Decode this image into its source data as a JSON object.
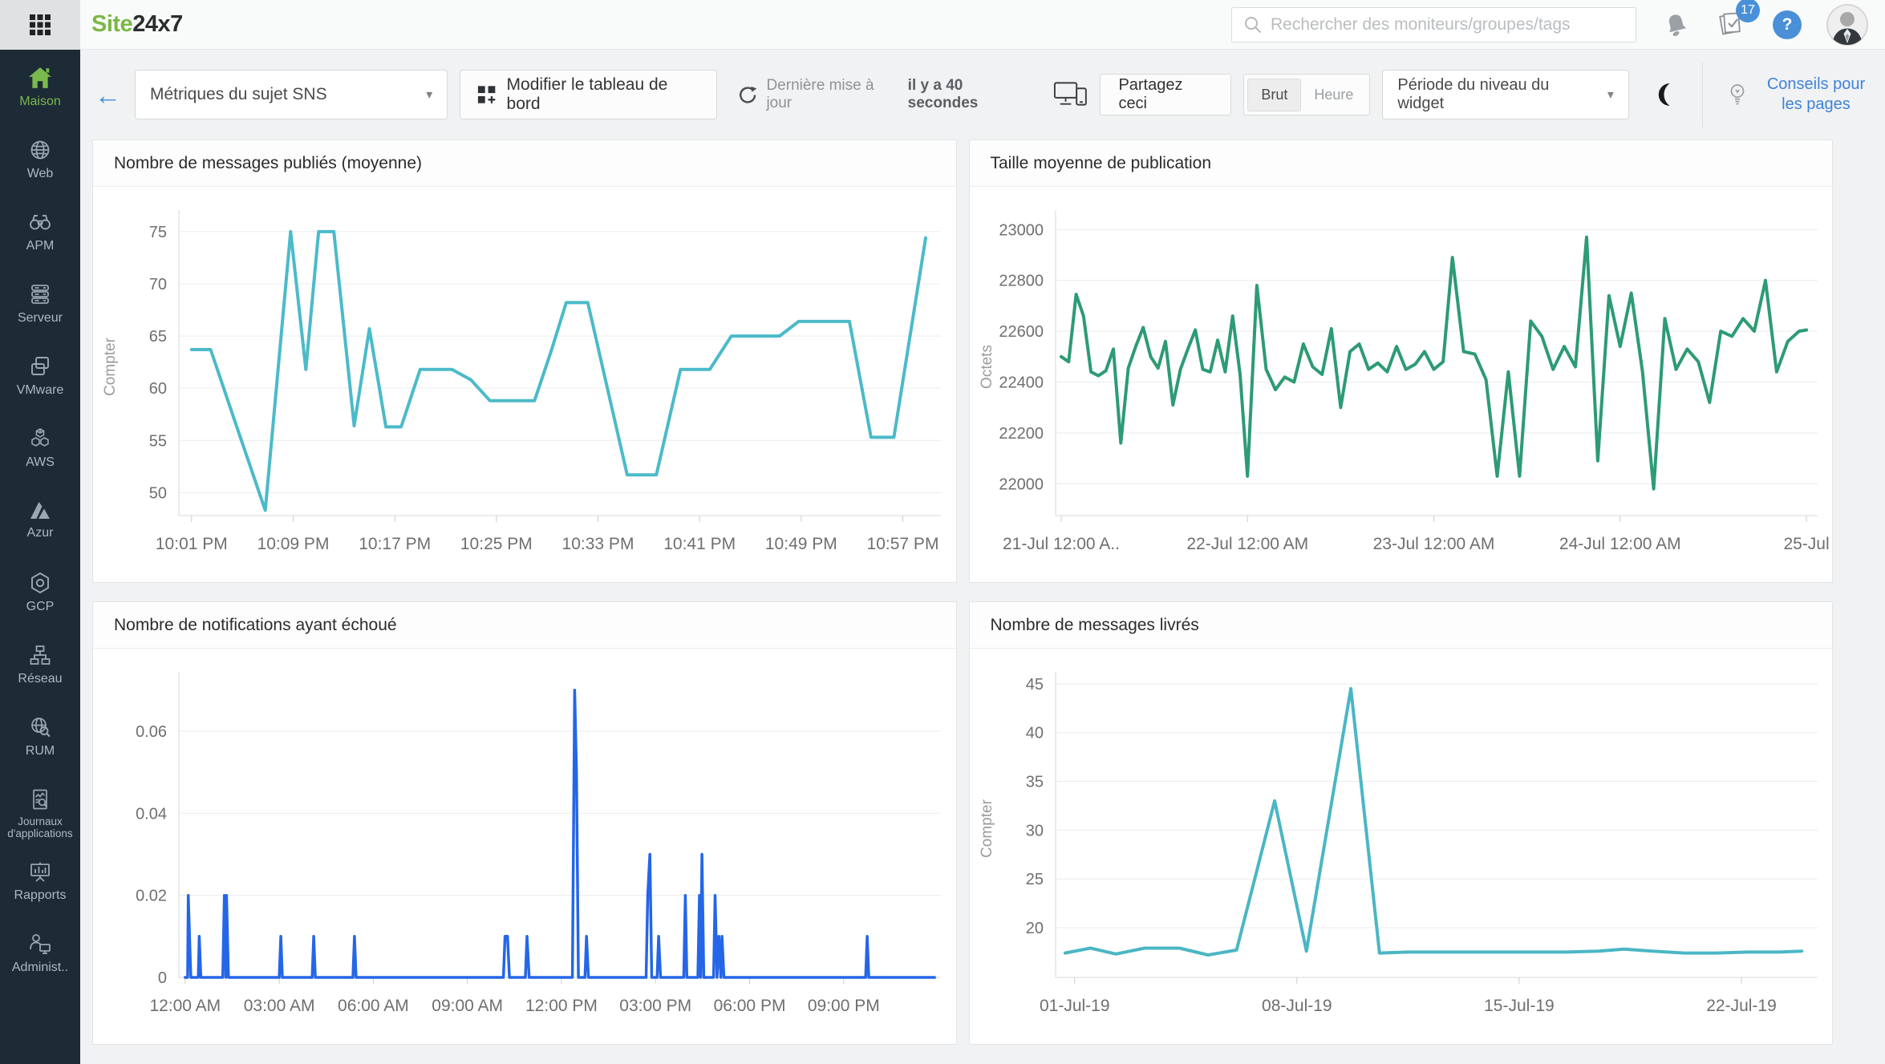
{
  "topbar": {
    "logo_site": "Site",
    "logo_rest": "24x7",
    "search_placeholder": "Rechercher des moniteurs/groupes/tags",
    "task_badge": "17",
    "help_glyph": "?"
  },
  "icons": {
    "back": "←",
    "caret": "▾"
  },
  "toolbar": {
    "dashboard_select": "Métriques du sujet SNS",
    "edit_button": "Modifier le tableau de bord",
    "last_update_label": "Dernière mise à jour",
    "last_update_value": "il y a 40 secondes",
    "share_button": "Partagez ceci",
    "toggle_raw": "Brut",
    "toggle_hour": "Heure",
    "period_select": "Période du niveau du widget",
    "tips_link": "Conseils pour les pages"
  },
  "sidebar": {
    "items": [
      {
        "label": "Maison",
        "active": true
      },
      {
        "label": "Web",
        "active": false
      },
      {
        "label": "APM",
        "active": false
      },
      {
        "label": "Serveur",
        "active": false
      },
      {
        "label": "VMware",
        "active": false
      },
      {
        "label": "AWS",
        "active": false
      },
      {
        "label": "Azur",
        "active": false
      },
      {
        "label": "GCP",
        "active": false
      },
      {
        "label": "Réseau",
        "active": false
      },
      {
        "label": "RUM",
        "active": false
      },
      {
        "label": "Journaux d'applications",
        "active": false
      },
      {
        "label": "Rapports",
        "active": false
      },
      {
        "label": "Administ..",
        "active": false
      }
    ]
  },
  "chart_data": [
    {
      "type": "line",
      "title": "Nombre de messages publiés (moyenne)",
      "ylabel": "Compter",
      "color": "#4bbac9",
      "stroke": 4,
      "xlim": [
        0,
        60
      ],
      "ylim": [
        47.8,
        76.3
      ],
      "yticks": [
        50,
        55,
        60,
        65,
        70,
        75
      ],
      "xticks": [
        {
          "v": 1,
          "label": "10:01 PM"
        },
        {
          "v": 9,
          "label": "10:09 PM"
        },
        {
          "v": 17,
          "label": "10:17 PM"
        },
        {
          "v": 25,
          "label": "10:25 PM"
        },
        {
          "v": 33,
          "label": "10:33 PM"
        },
        {
          "v": 41,
          "label": "10:41 PM"
        },
        {
          "v": 49,
          "label": "10:49 PM"
        },
        {
          "v": 57,
          "label": "10:57 PM"
        }
      ],
      "points": [
        [
          1,
          63.7
        ],
        [
          2.5,
          63.7
        ],
        [
          4.5,
          56.5
        ],
        [
          6.8,
          48.3
        ],
        [
          8.8,
          75
        ],
        [
          10,
          61.8
        ],
        [
          11,
          75
        ],
        [
          12.2,
          75
        ],
        [
          13.8,
          56.4
        ],
        [
          15,
          65.7
        ],
        [
          16.3,
          56.3
        ],
        [
          17.5,
          56.3
        ],
        [
          19,
          61.8
        ],
        [
          21.5,
          61.8
        ],
        [
          23,
          60.8
        ],
        [
          24.5,
          58.8
        ],
        [
          28,
          58.8
        ],
        [
          29.3,
          63.5
        ],
        [
          30.5,
          68.2
        ],
        [
          32.2,
          68.2
        ],
        [
          35.3,
          51.7
        ],
        [
          37.6,
          51.7
        ],
        [
          39.5,
          61.8
        ],
        [
          41.8,
          61.8
        ],
        [
          43.5,
          65
        ],
        [
          47.3,
          65
        ],
        [
          48.8,
          66.4
        ],
        [
          52.8,
          66.4
        ],
        [
          54.5,
          55.3
        ],
        [
          56.3,
          55.3
        ],
        [
          58.8,
          74.4
        ]
      ]
    },
    {
      "type": "line",
      "title": "Taille moyenne de publication",
      "ylabel": "Octets",
      "color": "#2d9b73",
      "stroke": 4,
      "xlim": [
        20.97,
        25.06
      ],
      "ylim": [
        21875,
        23045
      ],
      "yticks": [
        22000,
        22200,
        22400,
        22600,
        22800,
        23000
      ],
      "xticks": [
        {
          "v": 21,
          "label": "21-Jul 12:00 A.."
        },
        {
          "v": 22,
          "label": "22-Jul 12:00 AM"
        },
        {
          "v": 23,
          "label": "23-Jul 12:00 AM"
        },
        {
          "v": 24,
          "label": "24-Jul 12:00 AM"
        },
        {
          "v": 25,
          "label": "25-Jul"
        }
      ],
      "points": [
        [
          21.0,
          22500
        ],
        [
          21.04,
          22480
        ],
        [
          21.08,
          22745
        ],
        [
          21.12,
          22660
        ],
        [
          21.16,
          22440
        ],
        [
          21.2,
          22425
        ],
        [
          21.24,
          22445
        ],
        [
          21.28,
          22530
        ],
        [
          21.32,
          22160
        ],
        [
          21.36,
          22455
        ],
        [
          21.4,
          22540
        ],
        [
          21.44,
          22615
        ],
        [
          21.48,
          22500
        ],
        [
          21.52,
          22455
        ],
        [
          21.56,
          22560
        ],
        [
          21.6,
          22310
        ],
        [
          21.64,
          22450
        ],
        [
          21.68,
          22530
        ],
        [
          21.72,
          22605
        ],
        [
          21.76,
          22450
        ],
        [
          21.8,
          22440
        ],
        [
          21.84,
          22565
        ],
        [
          21.88,
          22440
        ],
        [
          21.92,
          22660
        ],
        [
          21.96,
          22430
        ],
        [
          22.0,
          22030
        ],
        [
          22.05,
          22780
        ],
        [
          22.1,
          22450
        ],
        [
          22.15,
          22370
        ],
        [
          22.2,
          22420
        ],
        [
          22.25,
          22400
        ],
        [
          22.3,
          22550
        ],
        [
          22.35,
          22460
        ],
        [
          22.4,
          22430
        ],
        [
          22.45,
          22610
        ],
        [
          22.5,
          22300
        ],
        [
          22.55,
          22520
        ],
        [
          22.6,
          22550
        ],
        [
          22.65,
          22450
        ],
        [
          22.7,
          22475
        ],
        [
          22.75,
          22440
        ],
        [
          22.8,
          22540
        ],
        [
          22.85,
          22450
        ],
        [
          22.9,
          22470
        ],
        [
          22.95,
          22520
        ],
        [
          23.0,
          22450
        ],
        [
          23.05,
          22480
        ],
        [
          23.1,
          22890
        ],
        [
          23.16,
          22520
        ],
        [
          23.22,
          22510
        ],
        [
          23.28,
          22410
        ],
        [
          23.34,
          22030
        ],
        [
          23.4,
          22440
        ],
        [
          23.46,
          22030
        ],
        [
          23.52,
          22640
        ],
        [
          23.58,
          22580
        ],
        [
          23.64,
          22450
        ],
        [
          23.7,
          22540
        ],
        [
          23.76,
          22460
        ],
        [
          23.82,
          22970
        ],
        [
          23.88,
          22090
        ],
        [
          23.94,
          22740
        ],
        [
          24.0,
          22540
        ],
        [
          24.06,
          22750
        ],
        [
          24.12,
          22440
        ],
        [
          24.18,
          21980
        ],
        [
          24.24,
          22650
        ],
        [
          24.3,
          22450
        ],
        [
          24.36,
          22530
        ],
        [
          24.42,
          22480
        ],
        [
          24.48,
          22320
        ],
        [
          24.54,
          22600
        ],
        [
          24.6,
          22580
        ],
        [
          24.66,
          22650
        ],
        [
          24.72,
          22600
        ],
        [
          24.78,
          22800
        ],
        [
          24.84,
          22440
        ],
        [
          24.9,
          22560
        ],
        [
          24.96,
          22600
        ],
        [
          25.0,
          22605
        ]
      ]
    },
    {
      "type": "line",
      "title": "Nombre de notifications ayant échoué",
      "ylabel": null,
      "color": "#2566e8",
      "stroke": 3.5,
      "xlim": [
        -0.2,
        24.1
      ],
      "ylim": [
        0,
        0.0725
      ],
      "yticks": [
        0,
        0.02,
        0.04,
        0.06
      ],
      "xticks": [
        {
          "v": 0,
          "label": "12:00 AM"
        },
        {
          "v": 3,
          "label": "03:00 AM"
        },
        {
          "v": 6,
          "label": "06:00 AM"
        },
        {
          "v": 9,
          "label": "09:00 AM"
        },
        {
          "v": 12,
          "label": "12:00 PM"
        },
        {
          "v": 15,
          "label": "03:00 PM"
        },
        {
          "v": 18,
          "label": "06:00 PM"
        },
        {
          "v": 21,
          "label": "09:00 PM"
        }
      ],
      "points": [
        [
          0,
          0
        ],
        [
          0.08,
          0
        ],
        [
          0.1,
          0.02
        ],
        [
          0.14,
          0.01
        ],
        [
          0.18,
          0
        ],
        [
          0.42,
          0
        ],
        [
          0.45,
          0.01
        ],
        [
          0.5,
          0
        ],
        [
          1.2,
          0
        ],
        [
          1.25,
          0.02
        ],
        [
          1.3,
          0
        ],
        [
          1.32,
          0.02
        ],
        [
          1.38,
          0
        ],
        [
          3.0,
          0
        ],
        [
          3.05,
          0.01
        ],
        [
          3.1,
          0
        ],
        [
          4.05,
          0
        ],
        [
          4.1,
          0.01
        ],
        [
          4.15,
          0
        ],
        [
          5.35,
          0
        ],
        [
          5.4,
          0.01
        ],
        [
          5.45,
          0
        ],
        [
          10.15,
          0
        ],
        [
          10.2,
          0.01
        ],
        [
          10.28,
          0.01
        ],
        [
          10.34,
          0
        ],
        [
          10.85,
          0
        ],
        [
          10.9,
          0.01
        ],
        [
          10.97,
          0
        ],
        [
          12.35,
          0
        ],
        [
          12.42,
          0.07
        ],
        [
          12.48,
          0.05
        ],
        [
          12.54,
          0
        ],
        [
          12.75,
          0
        ],
        [
          12.8,
          0.01
        ],
        [
          12.86,
          0
        ],
        [
          14.7,
          0
        ],
        [
          14.75,
          0.02
        ],
        [
          14.82,
          0.03
        ],
        [
          14.88,
          0
        ],
        [
          15.05,
          0
        ],
        [
          15.1,
          0.01
        ],
        [
          15.16,
          0
        ],
        [
          15.9,
          0
        ],
        [
          15.95,
          0.02
        ],
        [
          16.0,
          0
        ],
        [
          16.35,
          0
        ],
        [
          16.4,
          0.02
        ],
        [
          16.44,
          0
        ],
        [
          16.48,
          0.03
        ],
        [
          16.54,
          0
        ],
        [
          16.85,
          0
        ],
        [
          16.9,
          0.02
        ],
        [
          16.96,
          0
        ],
        [
          17.02,
          0.01
        ],
        [
          17.08,
          0
        ],
        [
          17.12,
          0.01
        ],
        [
          17.18,
          0
        ],
        [
          21.7,
          0
        ],
        [
          21.75,
          0.01
        ],
        [
          21.8,
          0
        ],
        [
          23.9,
          0
        ]
      ]
    },
    {
      "type": "line",
      "title": "Nombre de messages livrés",
      "ylabel": "Compter",
      "color": "#4ab6c5",
      "stroke": 4,
      "xlim": [
        0.4,
        24.4
      ],
      "ylim": [
        14.9,
        45.4
      ],
      "yticks": [
        20,
        25,
        30,
        35,
        40,
        45
      ],
      "xticks": [
        {
          "v": 1,
          "label": "01-Jul-19"
        },
        {
          "v": 8,
          "label": "08-Jul-19"
        },
        {
          "v": 15,
          "label": "15-Jul-19"
        },
        {
          "v": 22,
          "label": "22-Jul-19"
        }
      ],
      "points": [
        [
          0.7,
          17.4
        ],
        [
          1.5,
          17.9
        ],
        [
          2.3,
          17.3
        ],
        [
          3.2,
          17.9
        ],
        [
          4.3,
          17.9
        ],
        [
          5.2,
          17.2
        ],
        [
          6.1,
          17.7
        ],
        [
          7.3,
          33
        ],
        [
          8.3,
          17.6
        ],
        [
          9.7,
          44.5
        ],
        [
          10.6,
          17.4
        ],
        [
          11.5,
          17.5
        ],
        [
          12.5,
          17.5
        ],
        [
          13.5,
          17.5
        ],
        [
          14.5,
          17.5
        ],
        [
          15.5,
          17.5
        ],
        [
          16.5,
          17.5
        ],
        [
          17.5,
          17.6
        ],
        [
          18.3,
          17.8
        ],
        [
          19.2,
          17.6
        ],
        [
          20.2,
          17.4
        ],
        [
          21.2,
          17.4
        ],
        [
          22.2,
          17.5
        ],
        [
          23.2,
          17.5
        ],
        [
          23.9,
          17.6
        ]
      ]
    }
  ]
}
